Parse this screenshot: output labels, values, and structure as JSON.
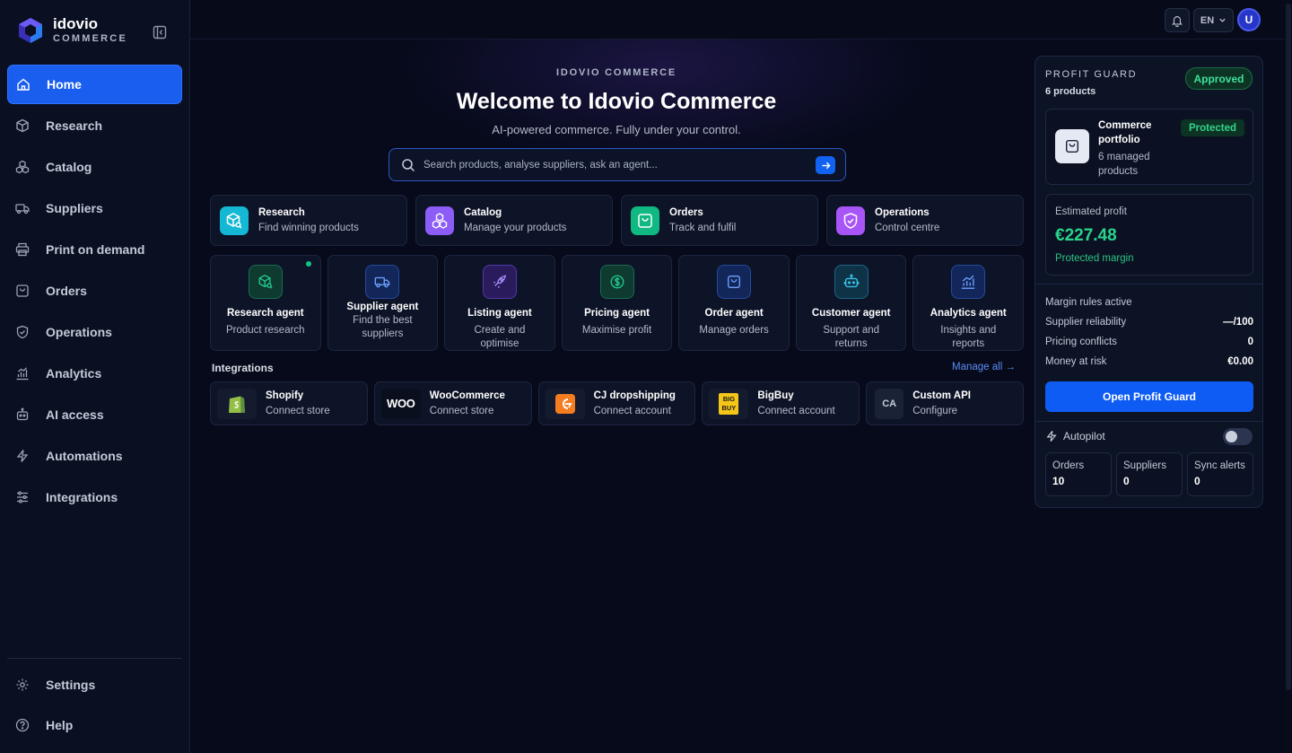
{
  "brand": {
    "name": "idovio",
    "sub": "COMMERCE"
  },
  "nav": {
    "items": [
      {
        "label": "Home",
        "icon": "home-icon"
      },
      {
        "label": "Research",
        "icon": "cube-search-icon"
      },
      {
        "label": "Catalog",
        "icon": "boxes-icon"
      },
      {
        "label": "Suppliers",
        "icon": "truck-icon"
      },
      {
        "label": "Print on demand",
        "icon": "printer-icon"
      },
      {
        "label": "Orders",
        "icon": "bag-icon"
      },
      {
        "label": "Operations",
        "icon": "shield-check-icon"
      },
      {
        "label": "Analytics",
        "icon": "chart-icon"
      },
      {
        "label": "AI access",
        "icon": "robot-icon"
      },
      {
        "label": "Automations",
        "icon": "bolt-icon"
      },
      {
        "label": "Integrations",
        "icon": "sliders-icon"
      }
    ],
    "active": "Home",
    "bottom": [
      {
        "label": "Settings",
        "icon": "gear-icon"
      },
      {
        "label": "Help",
        "icon": "help-icon"
      }
    ]
  },
  "topbar": {
    "language": "EN",
    "avatar_initial": "U"
  },
  "hero": {
    "eyebrow": "IDOVIO COMMERCE",
    "title": "Welcome to Idovio Commerce",
    "subtitle": "AI-powered commerce. Fully under your control.",
    "search_placeholder": "Search products, analyse suppliers, ask an agent..."
  },
  "quick_cards": [
    {
      "title": "Research",
      "sub": "Find winning products",
      "color": "#14b8d4"
    },
    {
      "title": "Catalog",
      "sub": "Manage your products",
      "color": "#8b5cf6"
    },
    {
      "title": "Orders",
      "sub": "Track and fulfil",
      "color": "#10b981"
    },
    {
      "title": "Operations",
      "sub": "Control centre",
      "color": "#a855f7"
    }
  ],
  "agents": [
    {
      "name": "Research agent",
      "desc": "Product research",
      "color": "#10b981",
      "status": "online"
    },
    {
      "name": "Supplier agent",
      "desc": "Find the best suppliers",
      "color": "#3b82f6"
    },
    {
      "name": "Listing agent",
      "desc": "Create and optimise",
      "color": "#8b5cf6"
    },
    {
      "name": "Pricing agent",
      "desc": "Maximise profit",
      "color": "#10b981"
    },
    {
      "name": "Order agent",
      "desc": "Manage orders",
      "color": "#3b82f6"
    },
    {
      "name": "Customer agent",
      "desc": "Support and returns",
      "color": "#22b8d4"
    },
    {
      "name": "Analytics agent",
      "desc": "Insights and reports",
      "color": "#3b82f6"
    }
  ],
  "integrations": {
    "label": "Integrations",
    "manage_all": "Manage all →",
    "items": [
      {
        "name": "Shopify",
        "action": "Connect store",
        "logo_text": ""
      },
      {
        "name": "WooCommerce",
        "action": "Connect store",
        "logo_text": "WOO"
      },
      {
        "name": "CJ dropshipping",
        "action": "Connect account",
        "logo_text": ""
      },
      {
        "name": "BigBuy",
        "action": "Connect account",
        "logo_text": "BIG BUY"
      },
      {
        "name": "Custom API",
        "action": "Configure",
        "logo_text": "CA"
      }
    ]
  },
  "profit_guard": {
    "title": "PROFIT GUARD",
    "count": "6 products",
    "status": "Approved",
    "portfolio": {
      "name": "Commerce portfolio",
      "sub": "6 managed products",
      "badge": "Protected"
    },
    "estimate": {
      "label": "Estimated profit",
      "value": "€227.48",
      "note": "Protected margin"
    },
    "rules": [
      {
        "label": "Margin rules active",
        "value": ""
      },
      {
        "label": "Supplier reliability",
        "value": "—/100"
      },
      {
        "label": "Pricing conflicts",
        "value": "0"
      },
      {
        "label": "Money at risk",
        "value": "€0.00"
      }
    ],
    "button": "Open Profit Guard",
    "autopilot": {
      "label": "Autopilot",
      "enabled": false
    },
    "stats": [
      {
        "label": "Orders",
        "value": "10"
      },
      {
        "label": "Suppliers",
        "value": "0"
      },
      {
        "label": "Sync alerts",
        "value": "0"
      }
    ]
  }
}
